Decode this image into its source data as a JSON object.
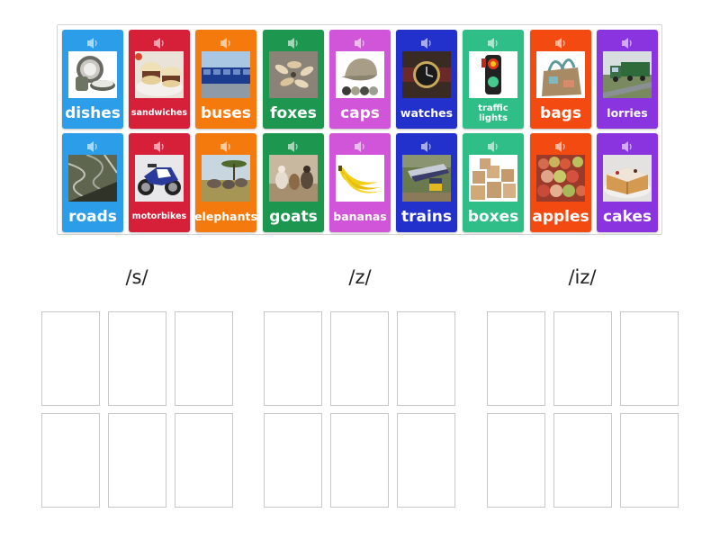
{
  "cards": [
    {
      "word": "dishes",
      "color": "#2c9de8",
      "image": "dishes-image"
    },
    {
      "word": "sandwiches",
      "color": "#d6203a",
      "image": "sandwiches-image"
    },
    {
      "word": "buses",
      "color": "#f47a0e",
      "image": "buses-image"
    },
    {
      "word": "foxes",
      "color": "#1d9650",
      "image": "foxes-image"
    },
    {
      "word": "caps",
      "color": "#d055d8",
      "image": "caps-image"
    },
    {
      "word": "watches",
      "color": "#2230cc",
      "image": "watches-image"
    },
    {
      "word": "traffic lights",
      "color": "#2fbe88",
      "image": "traffic-lights-image"
    },
    {
      "word": "bags",
      "color": "#f24a10",
      "image": "bags-image"
    },
    {
      "word": "lorries",
      "color": "#8a34e0",
      "image": "lorries-image"
    },
    {
      "word": "roads",
      "color": "#2c9de8",
      "image": "roads-image"
    },
    {
      "word": "motorbikes",
      "color": "#d6203a",
      "image": "motorbikes-image"
    },
    {
      "word": "elephants",
      "color": "#f47a0e",
      "image": "elephants-image"
    },
    {
      "word": "goats",
      "color": "#1d9650",
      "image": "goats-image"
    },
    {
      "word": "bananas",
      "color": "#d055d8",
      "image": "bananas-image"
    },
    {
      "word": "trains",
      "color": "#2230cc",
      "image": "trains-image"
    },
    {
      "word": "boxes",
      "color": "#2fbe88",
      "image": "boxes-image"
    },
    {
      "word": "apples",
      "color": "#f24a10",
      "image": "apples-image"
    },
    {
      "word": "cakes",
      "color": "#8a34e0",
      "image": "cakes-image"
    }
  ],
  "groups": [
    {
      "heading": "/s/",
      "slots": 6
    },
    {
      "heading": "/z/",
      "slots": 6
    },
    {
      "heading": "/iz/",
      "slots": 6
    }
  ],
  "icons": {
    "audio": "speaker-icon"
  }
}
